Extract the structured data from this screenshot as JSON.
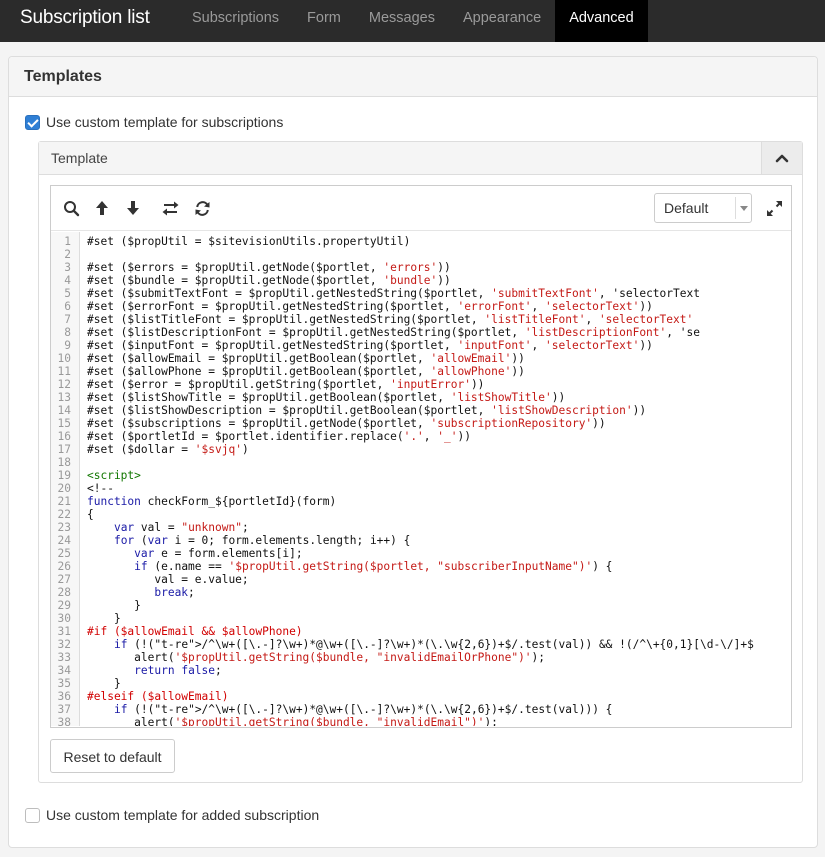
{
  "nav": {
    "brand": "Subscription list",
    "tabs": [
      {
        "label": "Subscriptions"
      },
      {
        "label": "Form"
      },
      {
        "label": "Messages"
      },
      {
        "label": "Appearance"
      },
      {
        "label": "Advanced"
      }
    ],
    "active_tab": "Advanced"
  },
  "panel": {
    "title": "Templates",
    "custom_subscriptions": {
      "label": "Use custom template for subscriptions",
      "checked": true
    },
    "template": {
      "header": "Template",
      "toolbar": {
        "icons": [
          "search-icon",
          "arrow-up-icon",
          "arrow-down-icon",
          "swap-icon",
          "refresh-icon",
          "expand-icon"
        ],
        "select_value": "Default"
      },
      "line_numbers": [
        "1",
        "2",
        "3",
        "4",
        "5",
        "6",
        "7",
        "8",
        "9",
        "10",
        "11",
        "12",
        "13",
        "14",
        "15",
        "16",
        "17",
        "18",
        "19",
        "20",
        "21",
        "22",
        "23",
        "24",
        "25",
        "26",
        "27",
        "28",
        "29",
        "30",
        "31",
        "32",
        "33",
        "34",
        "35",
        "36",
        "37",
        "38"
      ],
      "code_lines": [
        "#set ($propUtil = $sitevisionUtils.propertyUtil)",
        "",
        "#set ($errors = $propUtil.getNode($portlet, 'errors'))",
        "#set ($bundle = $propUtil.getNode($portlet, 'bundle'))",
        "#set ($submitTextFont = $propUtil.getNestedString($portlet, 'submitTextFont', 'selectorText",
        "#set ($errorFont = $propUtil.getNestedString($portlet, 'errorFont', 'selectorText'))",
        "#set ($listTitleFont = $propUtil.getNestedString($portlet, 'listTitleFont', 'selectorText'",
        "#set ($listDescriptionFont = $propUtil.getNestedString($portlet, 'listDescriptionFont', 'se",
        "#set ($inputFont = $propUtil.getNestedString($portlet, 'inputFont', 'selectorText'))",
        "#set ($allowEmail = $propUtil.getBoolean($portlet, 'allowEmail'))",
        "#set ($allowPhone = $propUtil.getBoolean($portlet, 'allowPhone'))",
        "#set ($error = $propUtil.getString($portlet, 'inputError'))",
        "#set ($listShowTitle = $propUtil.getBoolean($portlet, 'listShowTitle'))",
        "#set ($listShowDescription = $propUtil.getBoolean($portlet, 'listShowDescription'))",
        "#set ($subscriptions = $propUtil.getNode($portlet, 'subscriptionRepository'))",
        "#set ($portletId = $portlet.identifier.replace('.', '_'))",
        "#set ($dollar = '$svjq')",
        "",
        "<script>",
        "<!--",
        "function checkForm_${portletId}(form)",
        "{",
        "    var val = \"unknown\";",
        "    for (var i = 0; form.elements.length; i++) {",
        "       var e = form.elements[i];",
        "       if (e.name == '$propUtil.getString($portlet, \"subscriberInputName\")') {",
        "          val = e.value;",
        "          break;",
        "       }",
        "    }",
        "#if ($allowEmail && $allowPhone)",
        "    if (!(/^\\w+([\\.-]?\\w+)*@\\w+([\\.-]?\\w+)*(\\.\\w{2,6})+$/.test(val)) && !(/^\\+{0,1}[\\d-\\/]+$",
        "       alert('$propUtil.getString($bundle, \"invalidEmailOrPhone\")');",
        "       return false;",
        "    }",
        "#elseif ($allowEmail)",
        "    if (!(/^\\w+([\\.-]?\\w+)*@\\w+([\\.-]?\\w+)*(\\.\\w{2,6})+$/.test(val))) {",
        "       alert('$propUtil.getString($bundle, \"invalidEmail\")');"
      ],
      "reset_label": "Reset to default"
    },
    "custom_added": {
      "label": "Use custom template for added subscription",
      "checked": false
    }
  },
  "colors": {
    "nav_bg": "#2b2b2b",
    "active_tab_bg": "#000000",
    "checkbox_on": "#2f7fd5"
  }
}
